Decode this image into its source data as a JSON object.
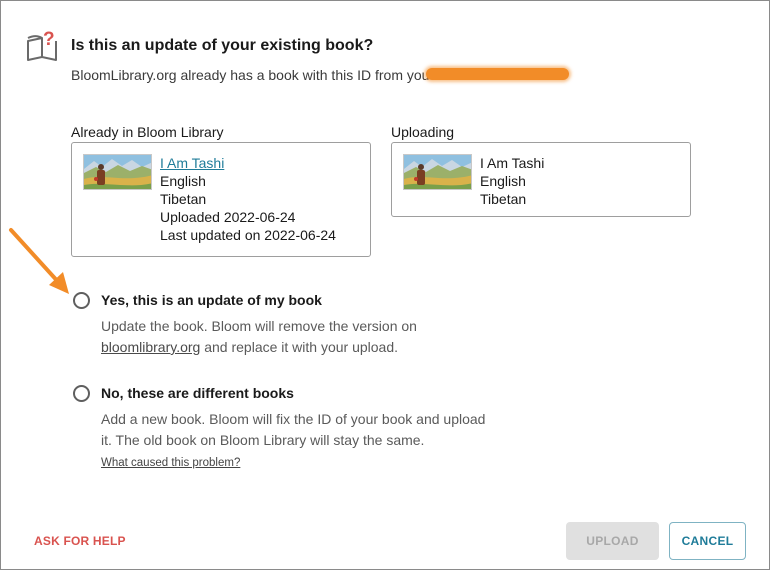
{
  "dialog": {
    "title": "Is this an update of your existing book?",
    "subtitle": "BloomLibrary.org already has a book with this ID from you",
    "icon": "book-question-icon",
    "accent_color": "#f28c28"
  },
  "existing": {
    "heading": "Already in Bloom Library",
    "book_title": "I Am Tashi",
    "language1": "English",
    "language2": "Tibetan",
    "uploaded": "Uploaded 2022-06-24",
    "last_updated": "Last updated on 2022-06-24"
  },
  "uploading": {
    "heading": "Uploading",
    "book_title": "I Am Tashi",
    "language1": "English",
    "language2": "Tibetan"
  },
  "options": {
    "update": {
      "title": "Yes, this is an update of my book",
      "desc_part1": "Update the book. Bloom will remove the version on",
      "desc_link": "bloomlibrary.org",
      "desc_part2": " and replace it with your upload."
    },
    "different": {
      "title": "No, these are different books",
      "desc": "Add a new book. Bloom will fix the ID of your book and upload it. The old book on Bloom Library will stay the same."
    },
    "problem_link": "What caused this problem?"
  },
  "footer": {
    "help_label": "ASK FOR HELP",
    "upload_label": "UPLOAD",
    "cancel_label": "CANCEL"
  },
  "colors": {
    "link": "#1f7c99",
    "help": "#d9534f",
    "disabled_bg": "#e0e0e0"
  }
}
